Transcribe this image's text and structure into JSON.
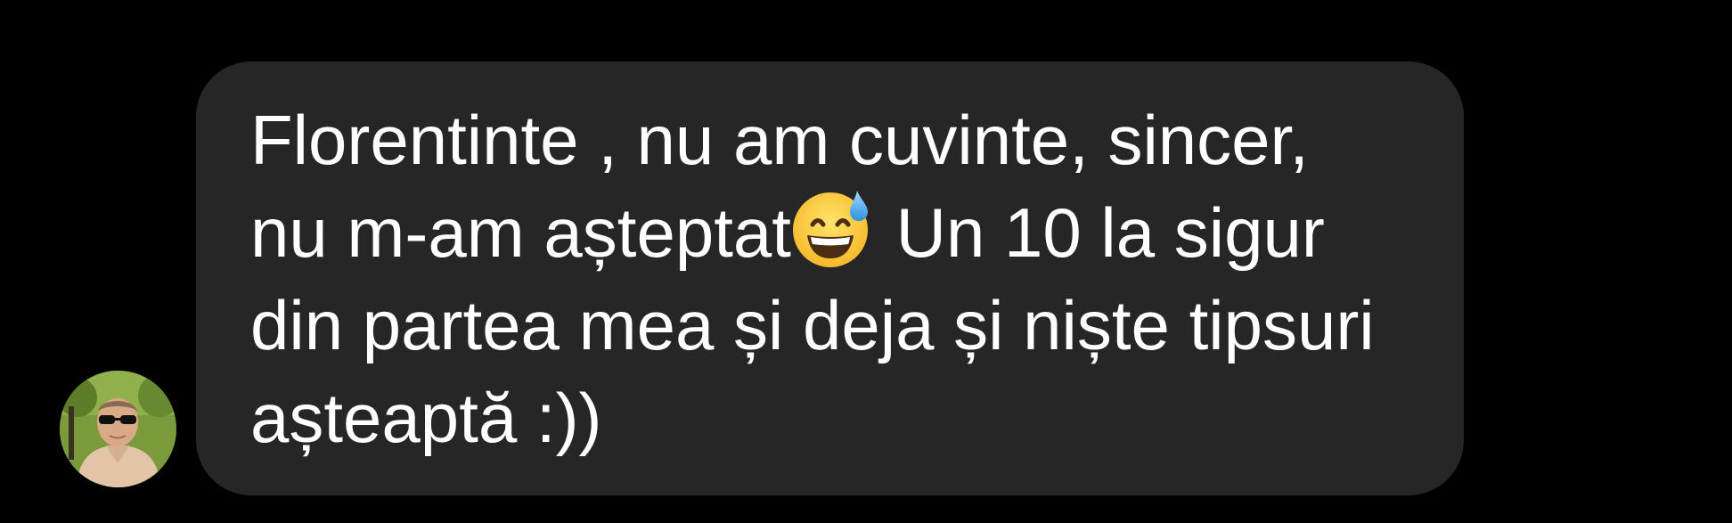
{
  "message": {
    "sender_avatar": "avatar-photo",
    "text_before_emoji": "Florentinte , nu am cuvinte, sincer,\nnu m-am așteptat",
    "emoji": "grinning-face-with-sweat-emoji",
    "text_after_emoji": " Un 10 la sigur\ndin partea mea și deja și niște tipsuri\nașteaptă :))"
  },
  "colors": {
    "background": "#000000",
    "bubble": "#262626",
    "text": "#ffffff"
  }
}
